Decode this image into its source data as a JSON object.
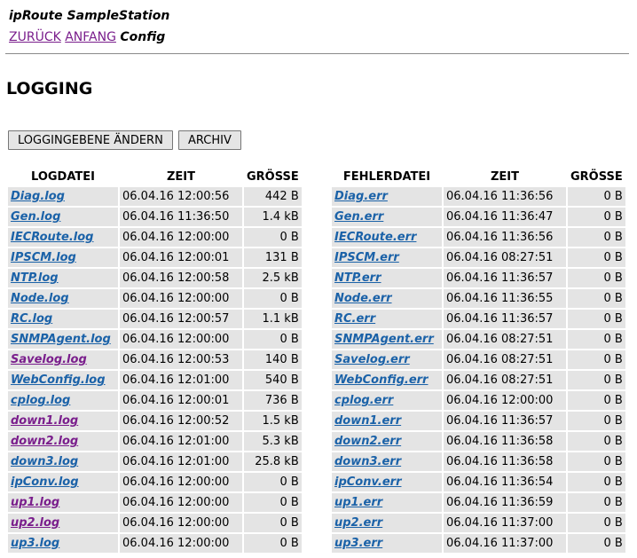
{
  "header": {
    "title": "ipRoute SampleStation"
  },
  "nav": {
    "back": "ZURÜCK",
    "home": "ANFANG",
    "current": "Config"
  },
  "page": {
    "title": "LOGGING"
  },
  "toolbar": {
    "change_label": "LOGGINGEBENE ÄNDERN",
    "archive_label": "ARCHIV"
  },
  "colors": {
    "link": "#1b62a8",
    "visited_link": "#7a1e8c",
    "cell_bg": "#e4e4e4"
  },
  "log_table": {
    "headers": [
      "LOGDATEI",
      "ZEIT",
      "GRÖSSE"
    ],
    "rows": [
      {
        "name": "Diag.log",
        "time": "06.04.16 12:00:56",
        "size": "442 B",
        "visited": false
      },
      {
        "name": "Gen.log",
        "time": "06.04.16 11:36:50",
        "size": "1.4 kB",
        "visited": false
      },
      {
        "name": "IECRoute.log",
        "time": "06.04.16 12:00:00",
        "size": "0 B",
        "visited": false
      },
      {
        "name": "IPSCM.log",
        "time": "06.04.16 12:00:01",
        "size": "131 B",
        "visited": false
      },
      {
        "name": "NTP.log",
        "time": "06.04.16 12:00:58",
        "size": "2.5 kB",
        "visited": false
      },
      {
        "name": "Node.log",
        "time": "06.04.16 12:00:00",
        "size": "0 B",
        "visited": false
      },
      {
        "name": "RC.log",
        "time": "06.04.16 12:00:57",
        "size": "1.1 kB",
        "visited": false
      },
      {
        "name": "SNMPAgent.log",
        "time": "06.04.16 12:00:00",
        "size": "0 B",
        "visited": false
      },
      {
        "name": "Savelog.log",
        "time": "06.04.16 12:00:53",
        "size": "140 B",
        "visited": true
      },
      {
        "name": "WebConfig.log",
        "time": "06.04.16 12:01:00",
        "size": "540 B",
        "visited": false
      },
      {
        "name": "cplog.log",
        "time": "06.04.16 12:00:01",
        "size": "736 B",
        "visited": false
      },
      {
        "name": "down1.log",
        "time": "06.04.16 12:00:52",
        "size": "1.5 kB",
        "visited": true
      },
      {
        "name": "down2.log",
        "time": "06.04.16 12:01:00",
        "size": "5.3 kB",
        "visited": true
      },
      {
        "name": "down3.log",
        "time": "06.04.16 12:01:00",
        "size": "25.8 kB",
        "visited": false
      },
      {
        "name": "ipConv.log",
        "time": "06.04.16 12:00:00",
        "size": "0 B",
        "visited": false
      },
      {
        "name": "up1.log",
        "time": "06.04.16 12:00:00",
        "size": "0 B",
        "visited": true
      },
      {
        "name": "up2.log",
        "time": "06.04.16 12:00:00",
        "size": "0 B",
        "visited": true
      },
      {
        "name": "up3.log",
        "time": "06.04.16 12:00:00",
        "size": "0 B",
        "visited": false
      }
    ]
  },
  "error_table": {
    "headers": [
      "FEHLERDATEI",
      "ZEIT",
      "GRÖSSE"
    ],
    "rows": [
      {
        "name": "Diag.err",
        "time": "06.04.16 11:36:56",
        "size": "0 B",
        "visited": false
      },
      {
        "name": "Gen.err",
        "time": "06.04.16 11:36:47",
        "size": "0 B",
        "visited": false
      },
      {
        "name": "IECRoute.err",
        "time": "06.04.16 11:36:56",
        "size": "0 B",
        "visited": false
      },
      {
        "name": "IPSCM.err",
        "time": "06.04.16 08:27:51",
        "size": "0 B",
        "visited": false
      },
      {
        "name": "NTP.err",
        "time": "06.04.16 11:36:57",
        "size": "0 B",
        "visited": false
      },
      {
        "name": "Node.err",
        "time": "06.04.16 11:36:55",
        "size": "0 B",
        "visited": false
      },
      {
        "name": "RC.err",
        "time": "06.04.16 11:36:57",
        "size": "0 B",
        "visited": false
      },
      {
        "name": "SNMPAgent.err",
        "time": "06.04.16 08:27:51",
        "size": "0 B",
        "visited": false
      },
      {
        "name": "Savelog.err",
        "time": "06.04.16 08:27:51",
        "size": "0 B",
        "visited": false
      },
      {
        "name": "WebConfig.err",
        "time": "06.04.16 08:27:51",
        "size": "0 B",
        "visited": false
      },
      {
        "name": "cplog.err",
        "time": "06.04.16 12:00:00",
        "size": "0 B",
        "visited": false
      },
      {
        "name": "down1.err",
        "time": "06.04.16 11:36:57",
        "size": "0 B",
        "visited": false
      },
      {
        "name": "down2.err",
        "time": "06.04.16 11:36:58",
        "size": "0 B",
        "visited": false
      },
      {
        "name": "down3.err",
        "time": "06.04.16 11:36:58",
        "size": "0 B",
        "visited": false
      },
      {
        "name": "ipConv.err",
        "time": "06.04.16 11:36:54",
        "size": "0 B",
        "visited": false
      },
      {
        "name": "up1.err",
        "time": "06.04.16 11:36:59",
        "size": "0 B",
        "visited": false
      },
      {
        "name": "up2.err",
        "time": "06.04.16 11:37:00",
        "size": "0 B",
        "visited": false
      },
      {
        "name": "up3.err",
        "time": "06.04.16 11:37:00",
        "size": "0 B",
        "visited": false
      }
    ]
  }
}
